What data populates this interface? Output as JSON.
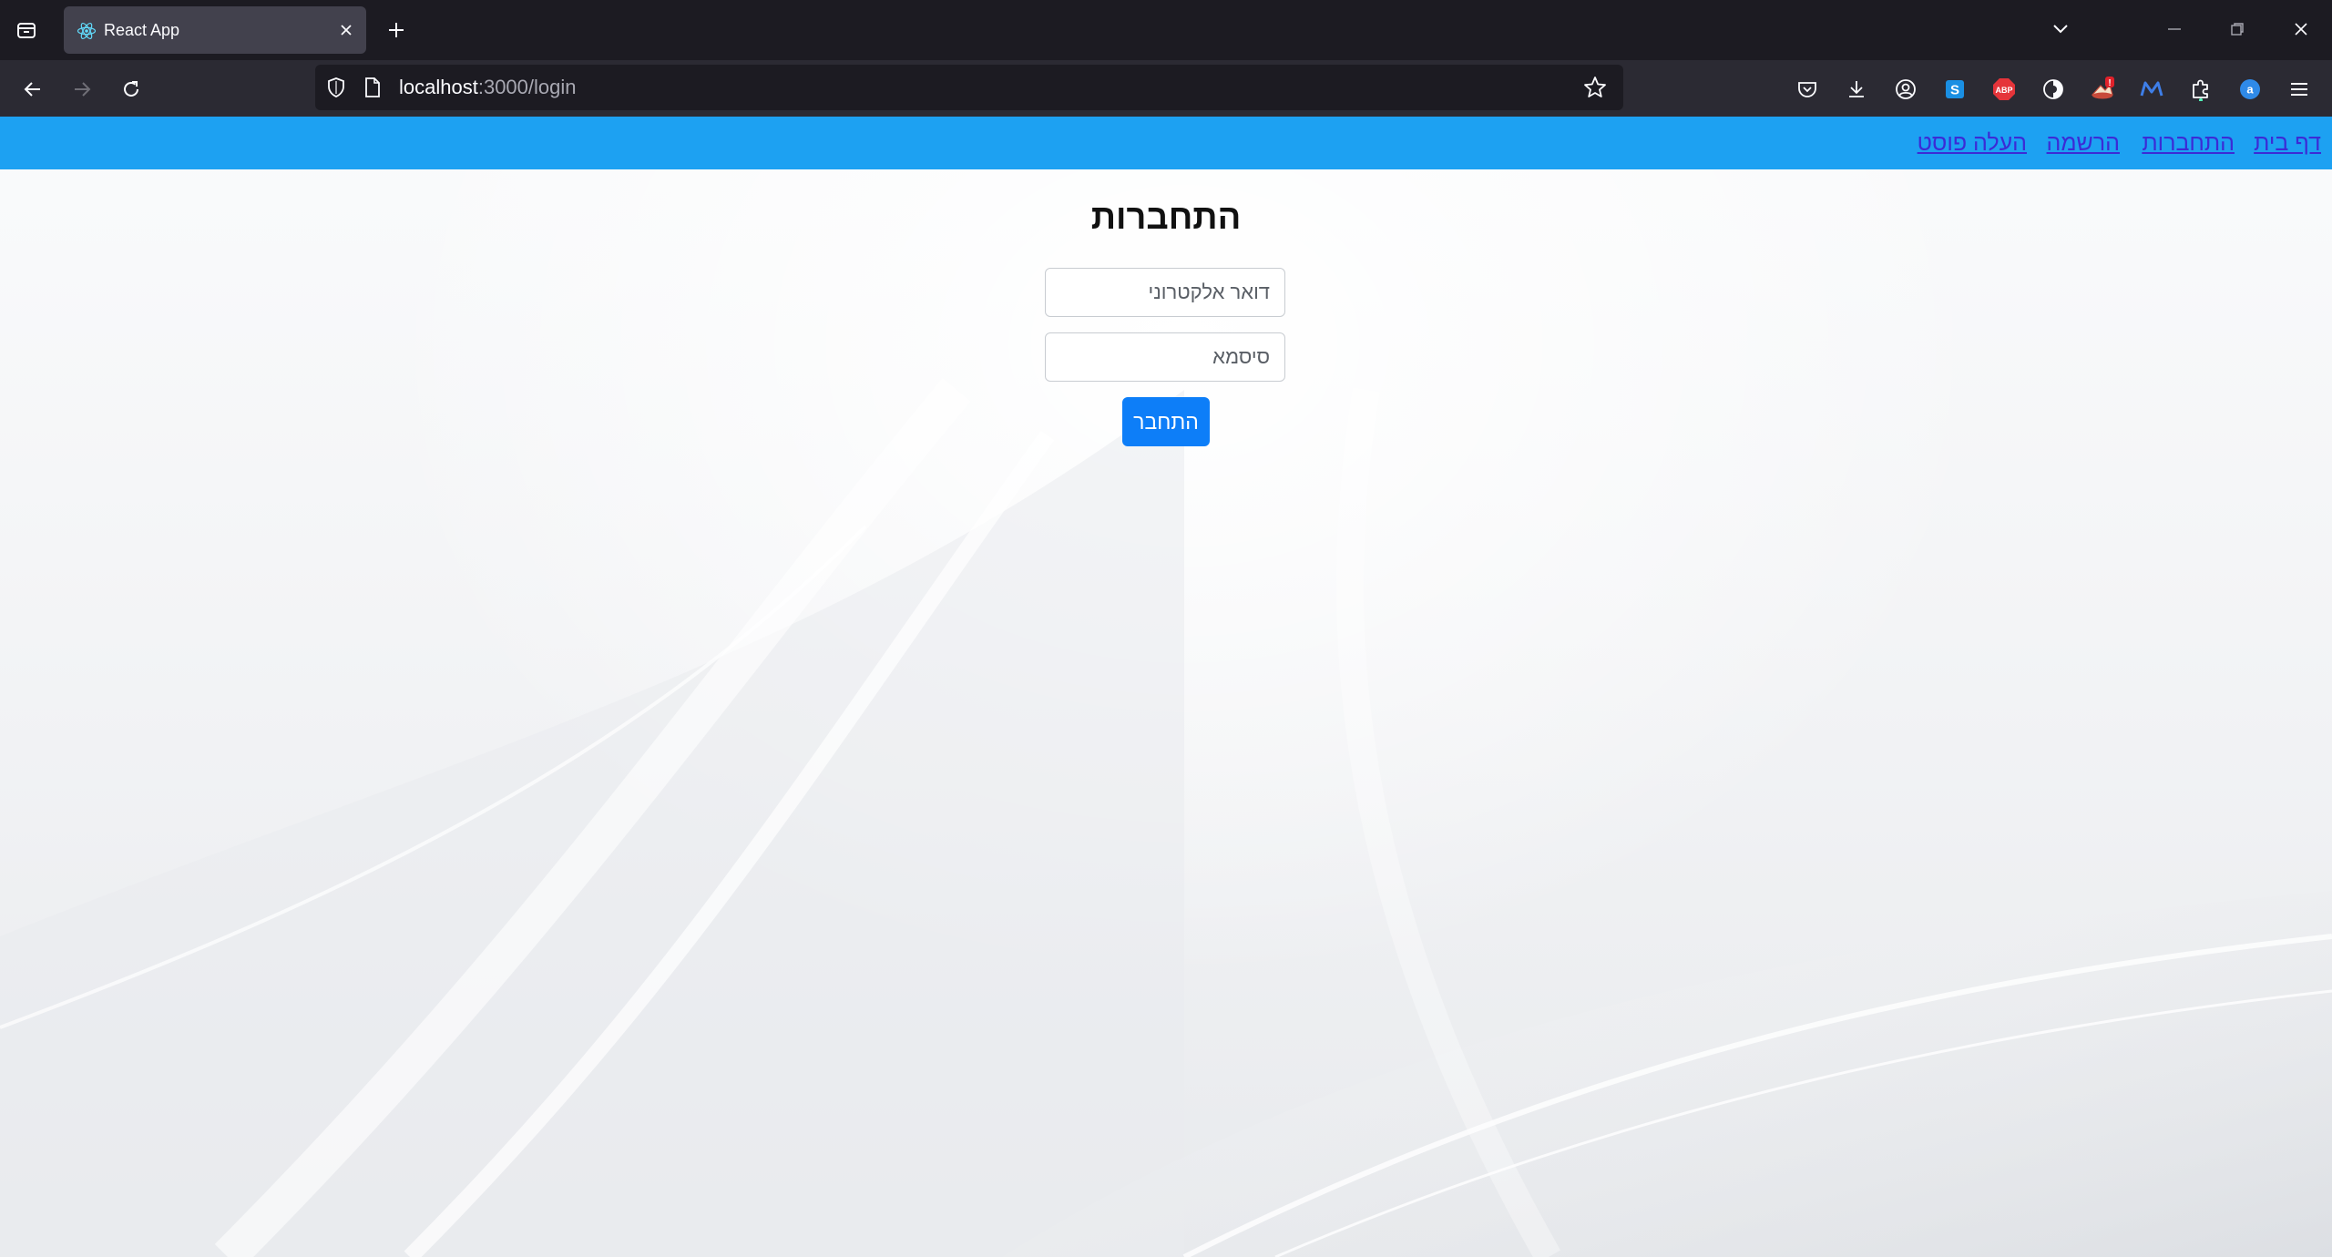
{
  "browser": {
    "tab": {
      "title": "React App"
    },
    "url": {
      "host": "localhost",
      "rest": ":3000/login"
    }
  },
  "app_nav": {
    "links": [
      "דף בית",
      "התחברות",
      "הרשמה",
      "העלה פוסט"
    ]
  },
  "login": {
    "title": "התחברות",
    "email_placeholder": "דואר אלקטרוני",
    "password_placeholder": "סיסמא",
    "submit_label": "התחבר"
  },
  "colors": {
    "chrome_dark": "#1c1b22",
    "toolbar": "#2b2a33",
    "app_nav_bg": "#1da1f2",
    "link": "#3b2bd6",
    "button": "#0d7ef8"
  },
  "extensions": [
    "pocket-icon",
    "download-icon",
    "account-icon",
    "s-extension-icon",
    "adblock-plus-icon",
    "privacy-badger-icon",
    "extension-alert-icon",
    "m-extension-icon",
    "puzzle-extensions-icon",
    "a-extension-icon",
    "app-menu-icon"
  ]
}
